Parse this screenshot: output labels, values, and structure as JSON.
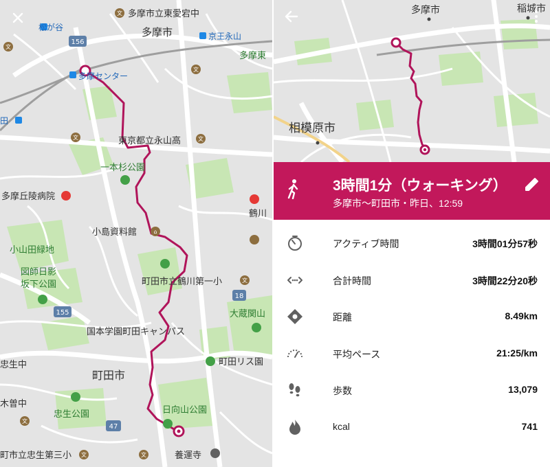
{
  "colors": {
    "accent": "#c2185b",
    "route": "#b0145a",
    "map_bg": "#e4e4e4",
    "park": "#c8e6b4"
  },
  "left_map": {
    "close_icon": "close-icon",
    "labels": {
      "l1": "多摩市立東愛宕中",
      "l2": "松が谷",
      "l3": "多摩市",
      "l4": "京王永山",
      "l5": "多摩東",
      "l6": "多摩センター",
      "l7": "田",
      "l8": "東京都立永山高",
      "l9": "一本杉公園",
      "l10": "多摩丘陵病院",
      "l11": "鶴川",
      "l12": "小島資料館",
      "l13": "小山田緑地",
      "l14": "図師日影",
      "l15": "坂下公園",
      "l16": "町田市立鶴川第一小",
      "l17": "大蔵関山",
      "l18": "国本学園町田キャンパス",
      "l19": "忠生中",
      "l20": "町田市",
      "l21": "町田リス園",
      "l22": "木曽中",
      "l23": "忠生公園",
      "l24": "日向山公園",
      "l25": "町市立忠生第三小",
      "l26": "養運寺"
    },
    "shields": {
      "s1": "156",
      "s2": "155",
      "s3": "18",
      "s4": "47"
    }
  },
  "right_map": {
    "back_icon": "back-arrow-icon",
    "labels": {
      "r1": "多摩市",
      "r2": "稲城市",
      "r3": "相模原市"
    }
  },
  "summary": {
    "title": "3時間1分（ウォーキング）",
    "subtitle": "多摩市〜町田市・昨日、12:59"
  },
  "stats": [
    {
      "icon": "timer-icon",
      "label": "アクティブ時間",
      "value": "3時間01分57秒"
    },
    {
      "icon": "duration-icon",
      "label": "合計時間",
      "value": "3時間22分20秒"
    },
    {
      "icon": "distance-icon",
      "label": "距離",
      "value": "8.49km"
    },
    {
      "icon": "speedometer-icon",
      "label": "平均ペース",
      "value": "21:25/km"
    },
    {
      "icon": "footsteps-icon",
      "label": "歩数",
      "value": "13,079"
    },
    {
      "icon": "flame-icon",
      "label": "kcal",
      "value": "741"
    }
  ]
}
